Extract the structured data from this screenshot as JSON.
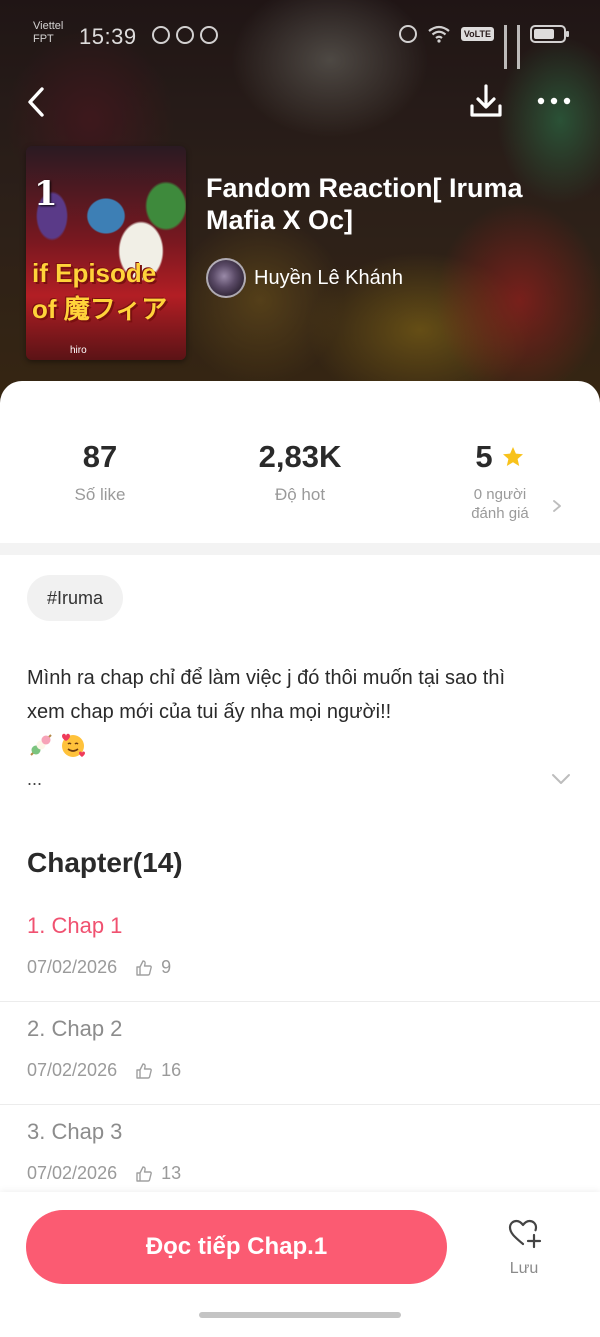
{
  "status_bar": {
    "carrier_line1": "Viettel",
    "carrier_line2": "FPT",
    "time": "15:39",
    "network_badge": "VoLTE"
  },
  "header": {
    "back_icon": "chevron-left-icon",
    "download_icon": "download-icon",
    "more_icon": "more-horizontal-icon"
  },
  "story": {
    "title": "Fandom Reaction[ Iruma Mafia X Oc]",
    "author": "Huyền Lê Khánh",
    "cover": {
      "volume": "1",
      "title_art": "if Episode of 魔フィア",
      "credit": "hiro"
    }
  },
  "stats": {
    "likes_value": "87",
    "likes_label": "Số like",
    "hot_value": "2,83K",
    "hot_label": "Độ hot",
    "rating_value": "5",
    "rating_label_line1": "0 người",
    "rating_label_line2": "đánh giá"
  },
  "tags": [
    "#Iruma"
  ],
  "description": {
    "text": "Mình ra chap chỉ để làm việc j đó thôi muốn tại sao thì xem chap mới của tui ấy nha mọi người!!",
    "truncation": "..."
  },
  "chapters": {
    "heading": "Chapter(14)",
    "items": [
      {
        "title": "1. Chap 1",
        "date": "07/02/2026",
        "likes": "9",
        "active": true
      },
      {
        "title": "2. Chap 2",
        "date": "07/02/2026",
        "likes": "16",
        "active": false
      },
      {
        "title": "3. Chap 3",
        "date": "07/02/2026",
        "likes": "13",
        "active": false
      }
    ]
  },
  "actions": {
    "read_label": "Đọc tiếp Chap.1",
    "save_label": "Lưu"
  },
  "colors": {
    "accent": "#fb5b72",
    "active_chapter": "#f05170",
    "star": "#f8c21b"
  }
}
